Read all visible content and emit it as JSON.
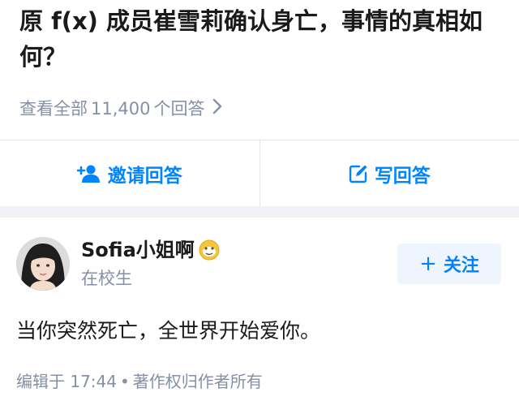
{
  "question": {
    "title": "原 f(x) 成员崔雪莉确认身亡，事情的真相如何？",
    "answers_prefix": "查看全部",
    "answers_count": "11,400",
    "answers_suffix": "个回答",
    "chevron_icon": "chevron-right-icon"
  },
  "actions": {
    "invite": {
      "label": "邀请回答",
      "icon": "add-user-icon"
    },
    "write": {
      "label": "写回答",
      "icon": "edit-icon"
    }
  },
  "answer": {
    "author": {
      "name": "Sofia小姐啊",
      "bio": "在校生",
      "badge_icon": "emoji-badge-icon"
    },
    "follow_label": "关注",
    "content": "当你突然死亡，全世界开始爱你。",
    "meta": {
      "edited": "编辑于 17:44",
      "separator": "•",
      "copyright": "著作权归作者所有"
    }
  },
  "colors": {
    "accent": "#0084ff",
    "muted": "#8590a6",
    "divider": "#f0f2f7",
    "follow_bg": "#eef5ff"
  }
}
